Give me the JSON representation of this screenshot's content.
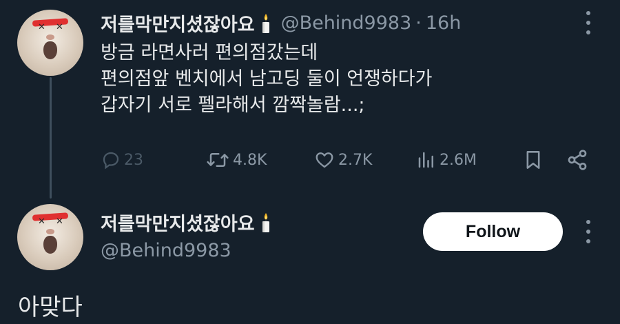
{
  "colors": {
    "background": "#15202b",
    "text_primary": "#e7e9ea",
    "text_secondary": "#8b98a5",
    "thread_line": "#3e4e5c",
    "follow_bg": "#ffffff",
    "follow_text": "#0f1419"
  },
  "tweet": {
    "display_name": "저를막만지셨잖아요",
    "name_emoji_icon": "candle-icon",
    "handle": "@Behind9983",
    "separator": "·",
    "time": "16h",
    "lines": [
      "방금 라면사러 편의점갔는데",
      "편의점앞 벤치에서 남고딩 둘이 언쟁하다가",
      "갑자기 서로 펠라해서 깜짝놀람...;"
    ],
    "actions": {
      "replies": "23",
      "retweets": "4.8K",
      "likes": "2.7K",
      "views": "2.6M"
    },
    "icons": {
      "reply": "reply-icon",
      "retweet": "retweet-icon",
      "like": "heart-icon",
      "views": "views-icon",
      "bookmark": "bookmark-icon",
      "share": "share-icon",
      "more": "more-icon"
    }
  },
  "reply": {
    "display_name": "저를막만지셨잖아요",
    "handle": "@Behind9983",
    "follow_label": "Follow",
    "text": "아맞다"
  }
}
